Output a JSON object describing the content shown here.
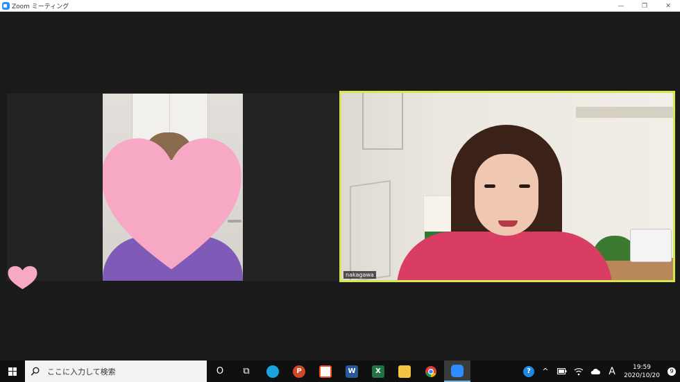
{
  "window": {
    "title": "Zoom ミーティング",
    "minimize": "—",
    "restore": "❐",
    "close": "✕"
  },
  "participants": [
    {
      "name": ""
    },
    {
      "name": "nakagawa",
      "speaking": true
    }
  ],
  "colors": {
    "active_speaker_border": "#d6e84a",
    "heart": "#f7a8c4",
    "taskbar_bg": "#101010"
  },
  "taskbar": {
    "search_placeholder": "ここに入力して検索",
    "cortana": "O",
    "taskview": "⧉",
    "apps": [
      {
        "name": "edge-icon",
        "label": ""
      },
      {
        "name": "powerpoint-icon",
        "label": "P"
      },
      {
        "name": "store-icon",
        "label": ""
      },
      {
        "name": "word-icon",
        "label": "W"
      },
      {
        "name": "excel-icon",
        "label": "X"
      },
      {
        "name": "explorer-icon",
        "label": ""
      },
      {
        "name": "chrome-icon",
        "label": ""
      },
      {
        "name": "zoom-icon",
        "label": ""
      }
    ],
    "tray": {
      "help": "?",
      "chevron": "^",
      "ime": "A",
      "time": "19:59",
      "date": "2020/10/20",
      "notifications": "9"
    }
  }
}
